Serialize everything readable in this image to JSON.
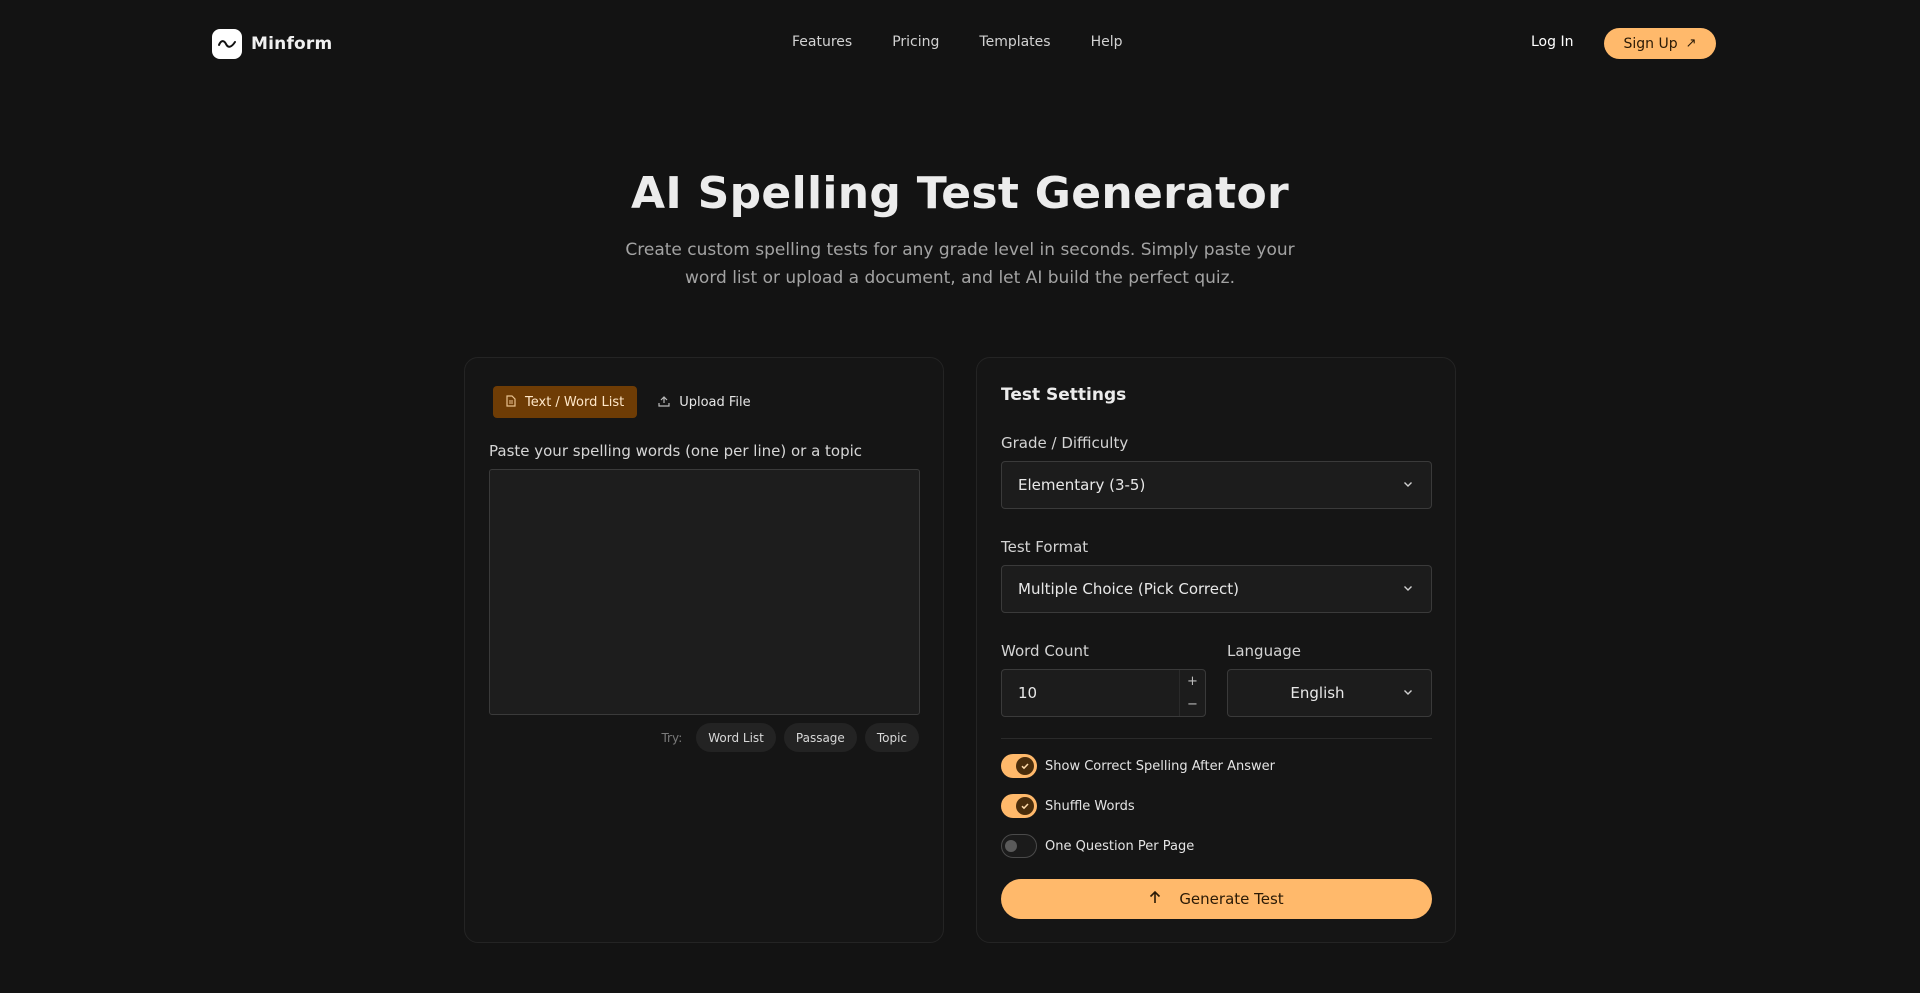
{
  "brand": {
    "name": "Minform"
  },
  "nav": {
    "links": [
      "Features",
      "Pricing",
      "Templates",
      "Help"
    ],
    "login": "Log In",
    "signup": "Sign Up"
  },
  "hero": {
    "title": "AI Spelling Test Generator",
    "subtitle": "Create custom spelling tests for any grade level in seconds. Simply paste your word list or upload a document, and let AI build the perfect quiz."
  },
  "input_panel": {
    "tabs": [
      {
        "label": "Text / Word List",
        "icon": "document-icon",
        "active": true
      },
      {
        "label": "Upload File",
        "icon": "upload-icon",
        "active": false
      }
    ],
    "textarea_label": "Paste your spelling words (one per line) or a topic",
    "textarea_value": "",
    "try_label": "Try:",
    "examples": [
      "Word List",
      "Passage",
      "Topic"
    ]
  },
  "settings": {
    "title": "Test Settings",
    "grade_label": "Grade / Difficulty",
    "grade_value": "Elementary (3-5)",
    "format_label": "Test Format",
    "format_value": "Multiple Choice (Pick Correct)",
    "word_count_label": "Word Count",
    "word_count_value": "10",
    "language_label": "Language",
    "language_value": "English",
    "toggles": [
      {
        "label": "Show Correct Spelling After Answer",
        "on": true
      },
      {
        "label": "Shuffle Words",
        "on": true
      },
      {
        "label": "One Question Per Page",
        "on": false
      }
    ],
    "generate_label": "Generate Test"
  },
  "colors": {
    "accent": "#ffb96b",
    "background": "#131313",
    "active_tab": "#6e3c05"
  }
}
